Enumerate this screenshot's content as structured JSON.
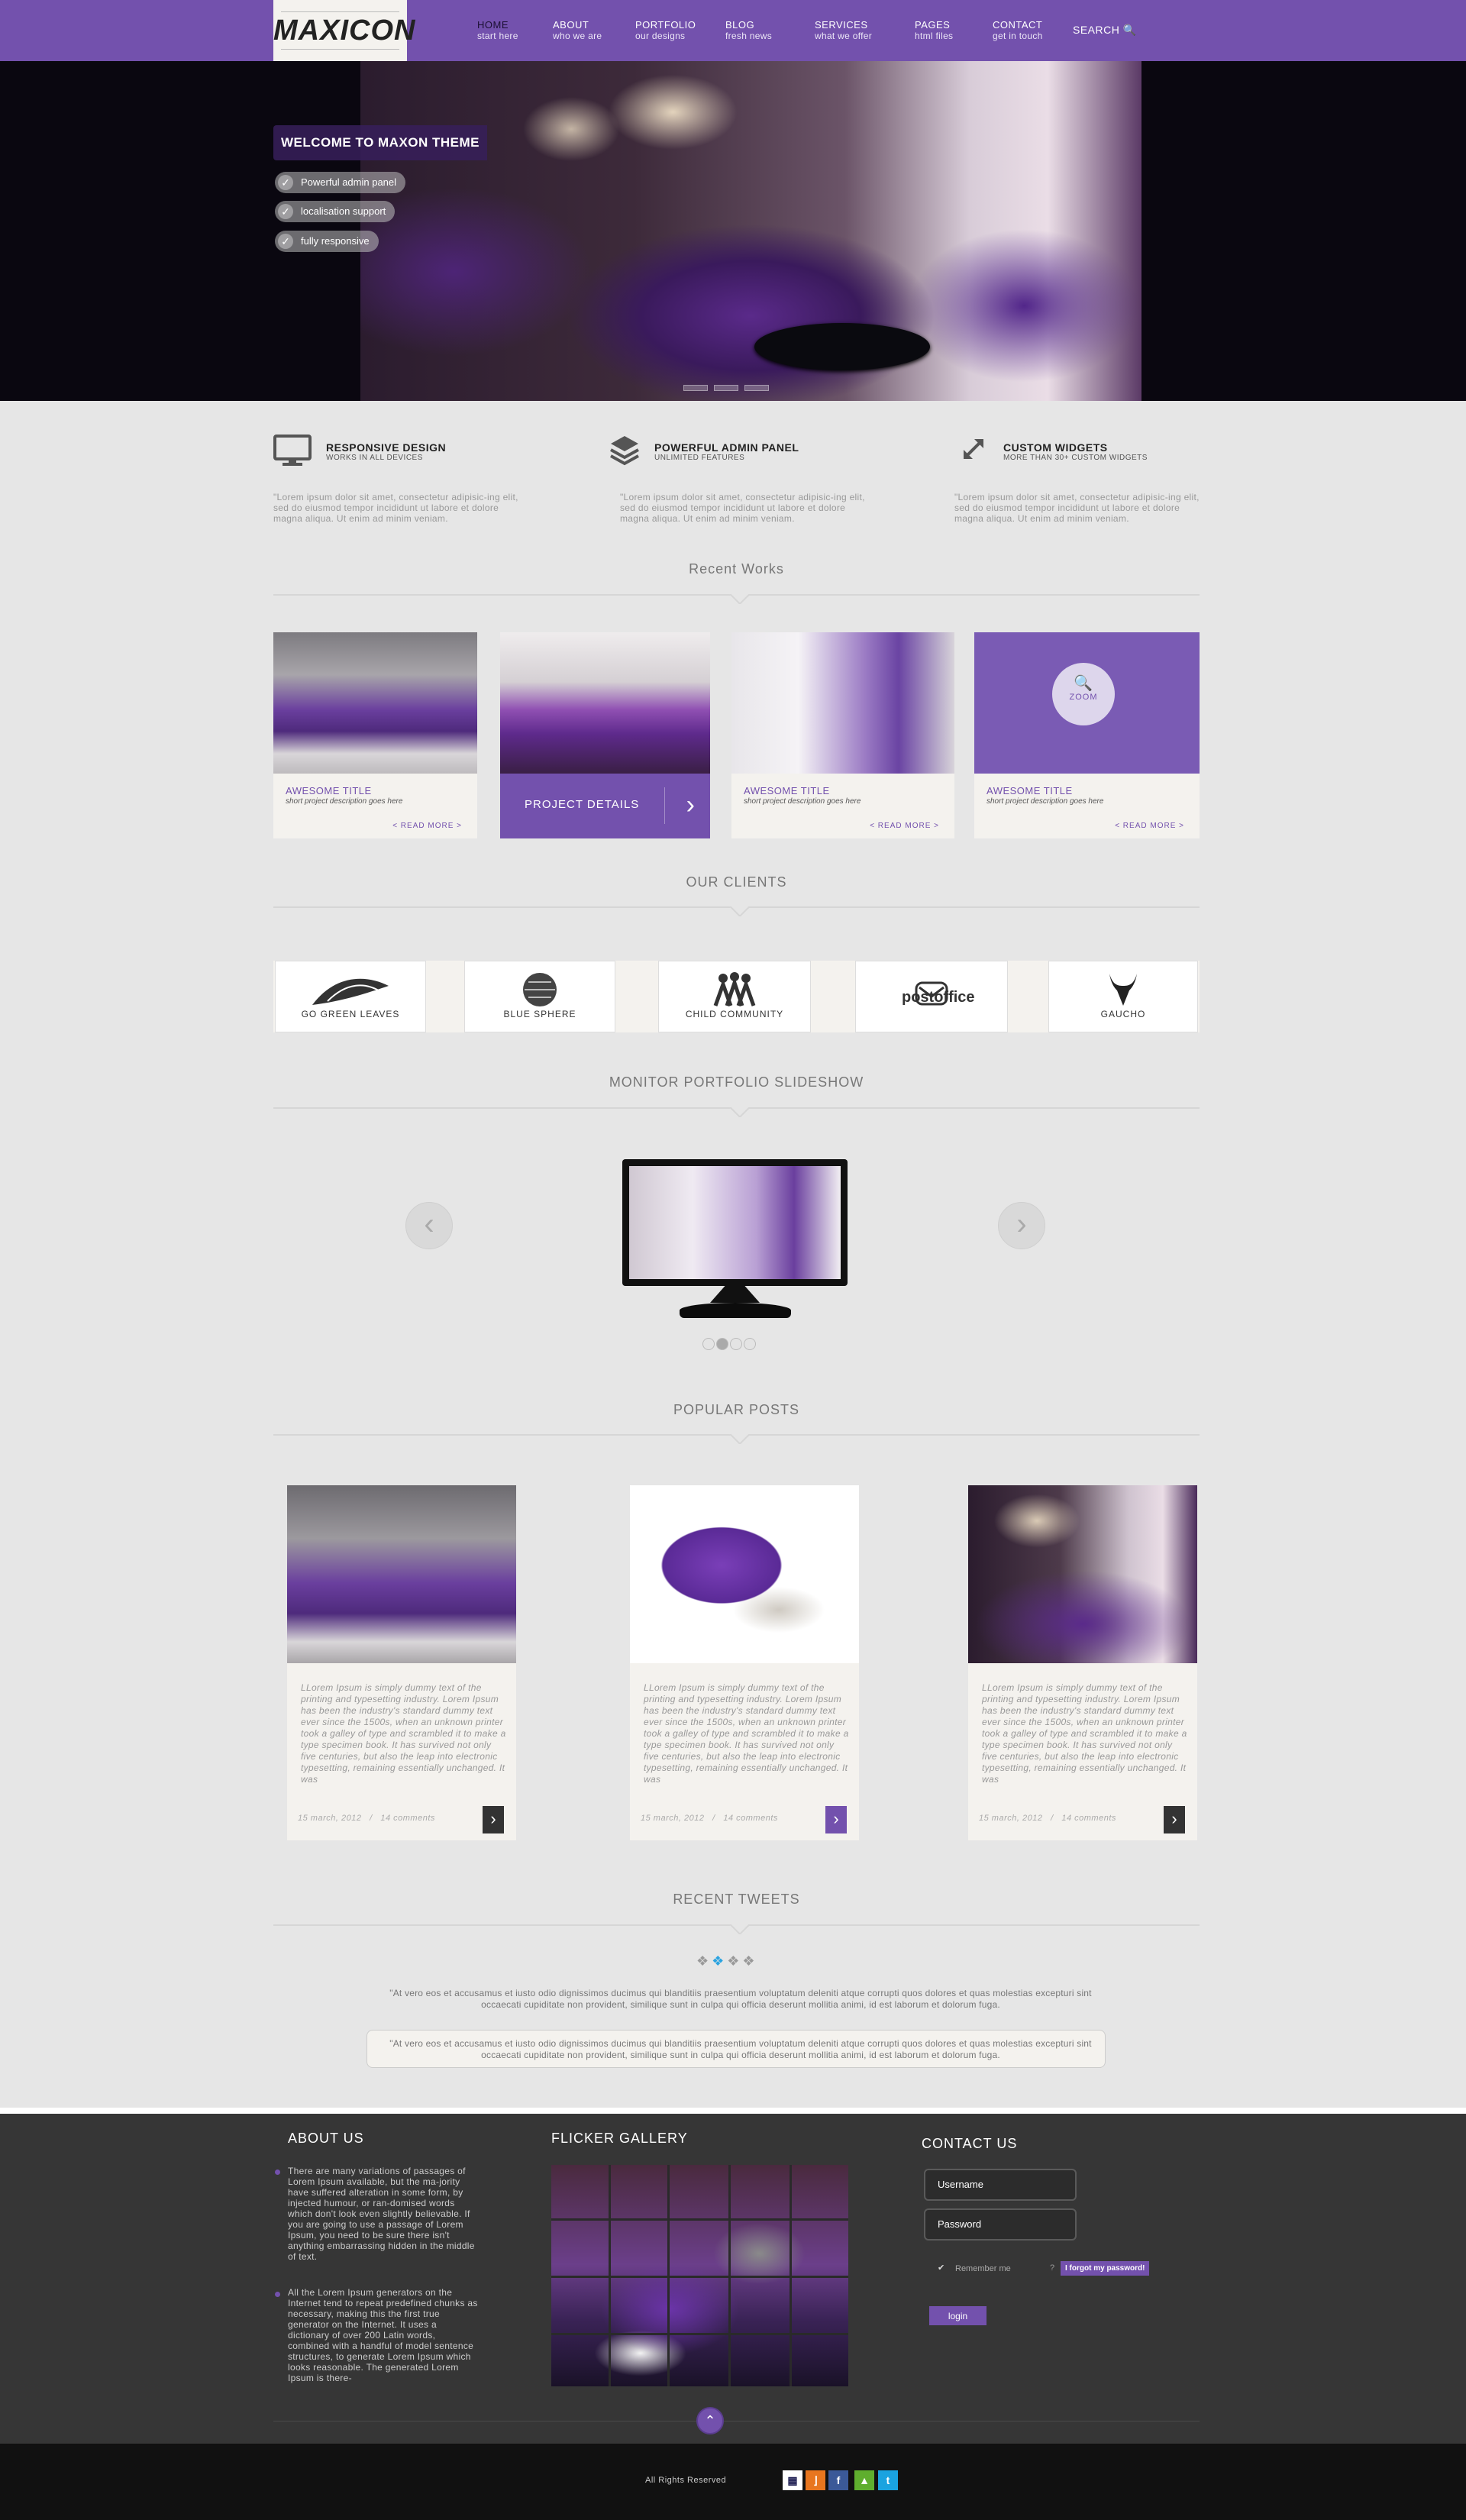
{
  "header": {
    "logo": "MAXICON",
    "nav": [
      {
        "label": "HOME",
        "sub": "start here"
      },
      {
        "label": "ABOUT",
        "sub": "who we are"
      },
      {
        "label": "PORTFOLIO",
        "sub": "our designs"
      },
      {
        "label": "BLOG",
        "sub": "fresh news"
      },
      {
        "label": "SERVICES",
        "sub": "what we offer"
      },
      {
        "label": "PAGES",
        "sub": "html files"
      },
      {
        "label": "CONTACT",
        "sub": "get in touch"
      }
    ],
    "search": "SEARCH",
    "active_index": 0
  },
  "hero": {
    "title": "WELCOME TO MAXON THEME",
    "features": [
      "Powerful admin panel",
      "localisation support",
      "fully responsive"
    ]
  },
  "features": [
    {
      "icon": "monitor-icon",
      "title": "RESPONSIVE DESIGN",
      "sub": "WORKS IN ALL DEVICES",
      "text": "\"Lorem ipsum dolor sit amet, consectetur adipisic-ing elit, sed do eiusmod tempor incididunt ut labore et dolore magna aliqua. Ut enim ad minim veniam."
    },
    {
      "icon": "layers-icon",
      "title": "POWERFUL ADMIN PANEL",
      "sub": "UNLIMITED FEATURES",
      "text": "\"Lorem ipsum dolor sit amet, consectetur adipisic-ing elit, sed do eiusmod tempor incididunt ut labore et dolore magna aliqua. Ut enim ad minim veniam."
    },
    {
      "icon": "resize-icon",
      "title": "CUSTOM WIDGETS",
      "sub": "MORE THAN 30+ CUSTOM WIDGETS",
      "text": "\"Lorem ipsum dolor sit amet, consectetur adipisic-ing elit, sed do eiusmod tempor incididunt ut labore et dolore magna aliqua. Ut enim ad minim veniam."
    }
  ],
  "recent_works": {
    "heading": "Recent Works",
    "items": [
      {
        "title": "AWESOME TITLE",
        "desc": "short project description goes here",
        "more": "< READ MORE >"
      },
      {
        "button": "PROJECT DETAILS"
      },
      {
        "title": "AWESOME TITLE",
        "desc": "short project description goes here",
        "more": "< READ MORE >"
      },
      {
        "title": "AWESOME TITLE",
        "desc": "short project description goes here",
        "more": "< READ MORE >",
        "zoom": "ZOOM"
      }
    ]
  },
  "clients": {
    "heading": "OUR CLIENTS",
    "logos": [
      "GO GREEN LEAVES",
      "BLUE SPHERE",
      "CHILD COMMUNITY",
      "postoffice",
      "GAUCHO"
    ]
  },
  "slideshow": {
    "heading": "MONITOR PORTFOLIO SLIDESHOW",
    "slide_count": 4,
    "active_slide": 2
  },
  "popular_posts": {
    "heading": "POPULAR POSTS",
    "items": [
      {
        "text": "LLorem Ipsum is simply dummy text of the printing and typesetting industry. Lorem Ipsum has been the industry's standard dummy text ever since the 1500s, when an unknown printer took a galley of type and scrambled it to make a type specimen book. It has survived not only five centuries, but also the leap into electronic typesetting, remaining essentially unchanged. It was",
        "date": "15 march, 2012",
        "comments": "14 comments"
      },
      {
        "text": "LLorem Ipsum is simply dummy text of the printing and typesetting industry. Lorem Ipsum has been the industry's standard dummy text ever since the 1500s, when an unknown printer took a galley of type and scrambled it to make a type specimen book. It has survived not only five centuries, but also the leap into electronic typesetting, remaining essentially unchanged. It was",
        "date": "15 march, 2012",
        "comments": "14 comments"
      },
      {
        "text": "LLorem Ipsum is simply dummy text of the printing and typesetting industry. Lorem Ipsum has been the industry's standard dummy text ever since the 1500s, when an unknown printer took a galley of type and scrambled it to make a type specimen book. It has survived not only five centuries, but also the leap into electronic typesetting, remaining essentially unchanged. It was",
        "date": "15 march, 2012",
        "comments": "14 comments"
      }
    ],
    "separator": "/"
  },
  "tweets": {
    "heading": "RECENT TWEETS",
    "items": [
      "\"At vero eos et accusamus et iusto odio dignissimos ducimus qui blanditiis praesentium voluptatum deleniti atque corrupti quos dolores et quas molestias excepturi sint occaecati cupiditate non provident, similique sunt in culpa qui officia deserunt mollitia animi, id est laborum et dolorum fuga.",
      "\"At vero eos et accusamus et iusto odio dignissimos ducimus qui blanditiis praesentium voluptatum deleniti atque corrupti quos dolores et quas molestias excepturi sint occaecati cupiditate non provident, similique sunt in culpa qui officia deserunt mollitia animi, id est laborum et dolorum fuga."
    ]
  },
  "footer": {
    "about_heading": "ABOUT US",
    "about": [
      "There are many variations of passages of Lorem Ipsum available, but the ma-jority have suffered alteration in some form, by injected humour, or ran-domised words which don't look even slightly believable. If you are going to use a passage of Lorem Ipsum, you need to be sure there isn't anything embarrassing hidden in the middle of text.",
      "All the Lorem Ipsum generators on the Internet tend to repeat predefined chunks as necessary, making this the first true generator on the Internet. It uses a dictionary of over 200 Latin words, combined with a handful of model sentence structures, to generate Lorem Ipsum which looks reasonable. The generated Lorem Ipsum is there-"
    ],
    "gallery_heading": "FLICKER GALLERY",
    "contact_heading": "CONTACT US",
    "username": "Username",
    "password": "Password",
    "remember": "Remember me",
    "forgot": "I forgot my password!",
    "login": "login",
    "rights": "All Rights Reserved"
  },
  "colors": {
    "accent": "#7351ad",
    "dark": "#363636",
    "bg": "#e6e6e6"
  }
}
